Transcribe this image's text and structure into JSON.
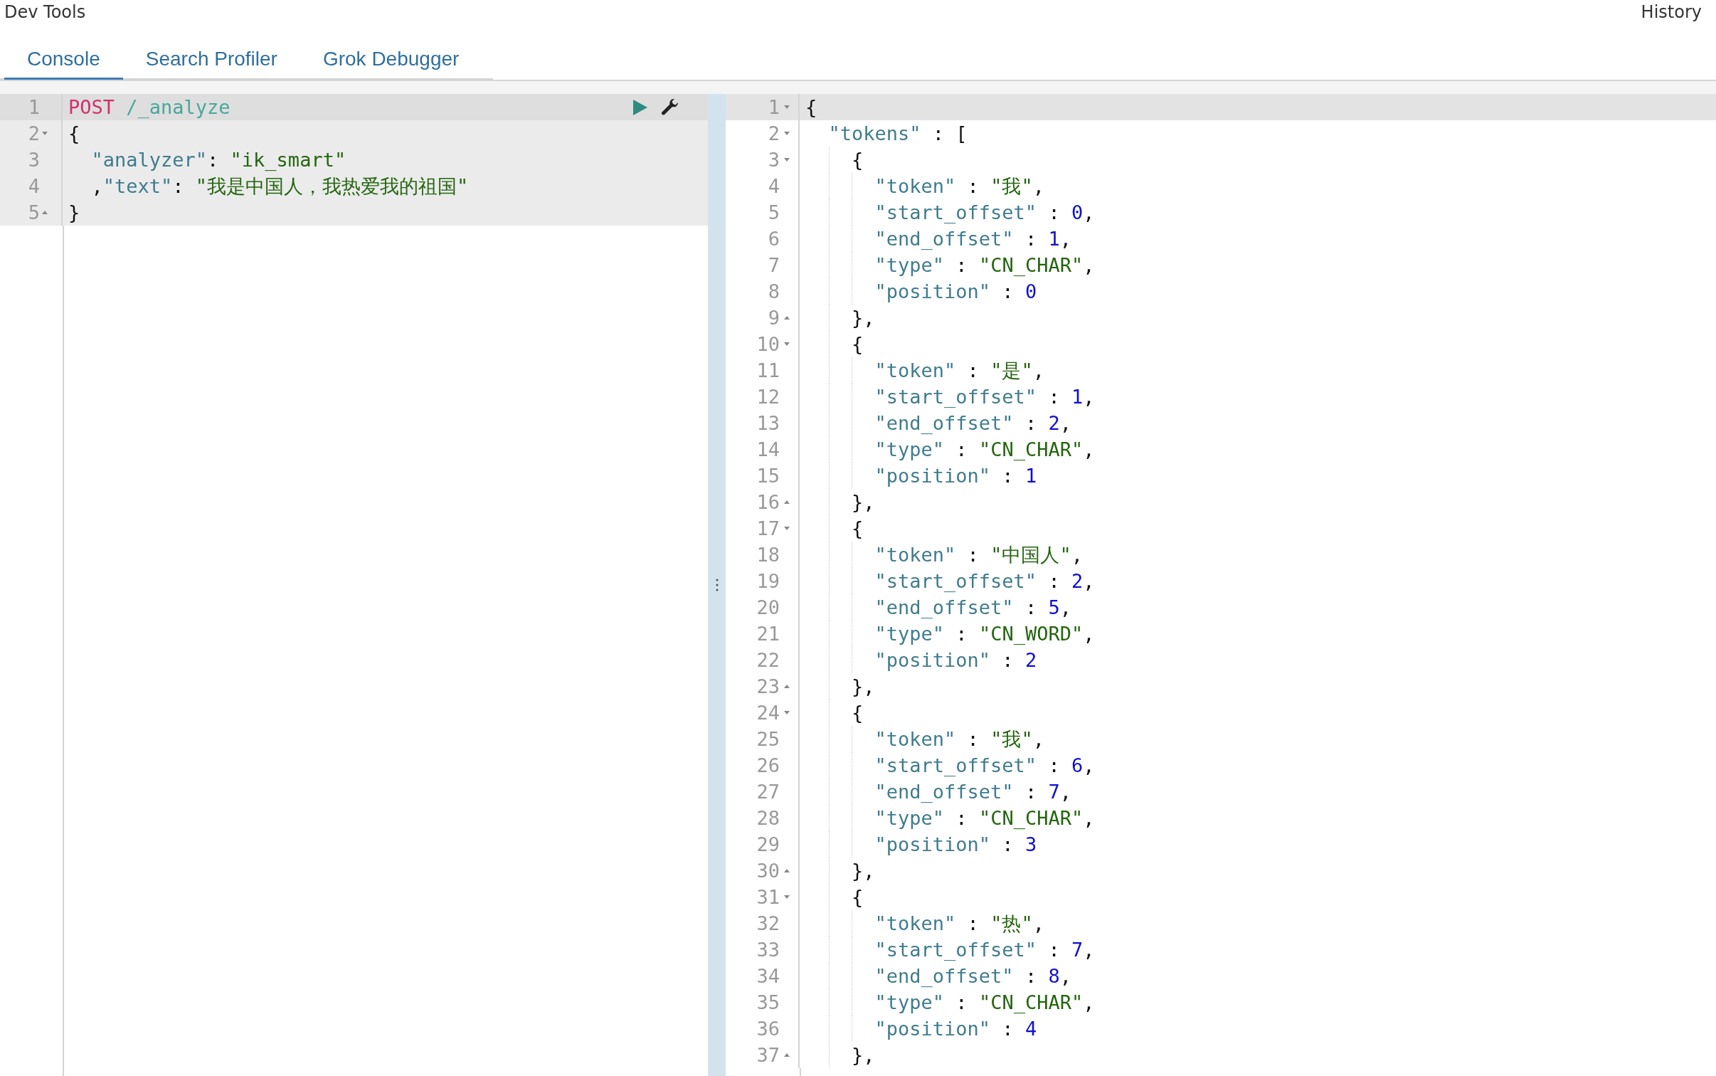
{
  "header": {
    "title": "Dev Tools",
    "history_link": "History"
  },
  "tabs": [
    {
      "label": "Console",
      "selected": true
    },
    {
      "label": "Search Profiler",
      "selected": false
    },
    {
      "label": "Grok Debugger",
      "selected": false
    }
  ],
  "request_editor": {
    "lines": [
      {
        "number": "1",
        "kind": "plain",
        "active": true,
        "in_request": true,
        "actions": true,
        "segments": [
          {
            "kind": "method",
            "text": "POST"
          },
          {
            "kind": "path",
            "text": "/_analyze"
          }
        ]
      },
      {
        "number": "2",
        "kind": "fold_start",
        "active": false,
        "in_request": true,
        "actions": false,
        "segments": [
          {
            "kind": "punct",
            "text": "{"
          }
        ]
      },
      {
        "number": "3",
        "kind": "plain",
        "active": false,
        "in_request": true,
        "actions": false,
        "segments": [
          {
            "kind": "key",
            "text": "\"analyzer\""
          },
          {
            "kind": "punct",
            "text": ": "
          },
          {
            "kind": "string",
            "text": "\"ik_smart\""
          }
        ]
      },
      {
        "number": "4",
        "kind": "plain",
        "active": false,
        "in_request": true,
        "actions": false,
        "segments": [
          {
            "kind": "punct",
            "text": ","
          },
          {
            "kind": "key",
            "text": "\"text\""
          },
          {
            "kind": "punct",
            "text": ": "
          },
          {
            "kind": "string",
            "text": "\"我是中国人，我热爱我的祖国\""
          }
        ]
      },
      {
        "number": "5",
        "kind": "fold_end",
        "active": false,
        "in_request": true,
        "actions": false,
        "segments": [
          {
            "kind": "punct",
            "text": "}"
          }
        ]
      }
    ]
  },
  "response_editor": {
    "lines": [
      {
        "number": "1",
        "kind": "fold_start",
        "active": true,
        "segments": [
          {
            "kind": "punct",
            "text": "{"
          }
        ]
      },
      {
        "number": "2",
        "kind": "fold_start",
        "active": false,
        "segments": [
          {
            "kind": "key",
            "text": "\"tokens\""
          },
          {
            "kind": "punct",
            "text": " : ["
          }
        ]
      },
      {
        "number": "3",
        "kind": "fold_start",
        "active": false,
        "segments": [
          {
            "kind": "punct",
            "text": "{"
          }
        ]
      },
      {
        "number": "4",
        "kind": "plain",
        "active": false,
        "segments": [
          {
            "kind": "key",
            "text": "\"token\""
          },
          {
            "kind": "punct",
            "text": " : "
          },
          {
            "kind": "string",
            "text": "\"我\""
          },
          {
            "kind": "punct",
            "text": ","
          }
        ]
      },
      {
        "number": "5",
        "kind": "plain",
        "active": false,
        "segments": [
          {
            "kind": "key",
            "text": "\"start_offset\""
          },
          {
            "kind": "punct",
            "text": " : "
          },
          {
            "kind": "number",
            "text": "0"
          },
          {
            "kind": "punct",
            "text": ","
          }
        ]
      },
      {
        "number": "6",
        "kind": "plain",
        "active": false,
        "segments": [
          {
            "kind": "key",
            "text": "\"end_offset\""
          },
          {
            "kind": "punct",
            "text": " : "
          },
          {
            "kind": "number",
            "text": "1"
          },
          {
            "kind": "punct",
            "text": ","
          }
        ]
      },
      {
        "number": "7",
        "kind": "plain",
        "active": false,
        "segments": [
          {
            "kind": "key",
            "text": "\"type\""
          },
          {
            "kind": "punct",
            "text": " : "
          },
          {
            "kind": "string",
            "text": "\"CN_CHAR\""
          },
          {
            "kind": "punct",
            "text": ","
          }
        ]
      },
      {
        "number": "8",
        "kind": "plain",
        "active": false,
        "segments": [
          {
            "kind": "key",
            "text": "\"position\""
          },
          {
            "kind": "punct",
            "text": " : "
          },
          {
            "kind": "number",
            "text": "0"
          }
        ]
      },
      {
        "number": "9",
        "kind": "fold_end",
        "active": false,
        "segments": [
          {
            "kind": "punct",
            "text": "},"
          }
        ]
      },
      {
        "number": "10",
        "kind": "fold_start",
        "active": false,
        "segments": [
          {
            "kind": "punct",
            "text": "{"
          }
        ]
      },
      {
        "number": "11",
        "kind": "plain",
        "active": false,
        "segments": [
          {
            "kind": "key",
            "text": "\"token\""
          },
          {
            "kind": "punct",
            "text": " : "
          },
          {
            "kind": "string",
            "text": "\"是\""
          },
          {
            "kind": "punct",
            "text": ","
          }
        ]
      },
      {
        "number": "12",
        "kind": "plain",
        "active": false,
        "segments": [
          {
            "kind": "key",
            "text": "\"start_offset\""
          },
          {
            "kind": "punct",
            "text": " : "
          },
          {
            "kind": "number",
            "text": "1"
          },
          {
            "kind": "punct",
            "text": ","
          }
        ]
      },
      {
        "number": "13",
        "kind": "plain",
        "active": false,
        "segments": [
          {
            "kind": "key",
            "text": "\"end_offset\""
          },
          {
            "kind": "punct",
            "text": " : "
          },
          {
            "kind": "number",
            "text": "2"
          },
          {
            "kind": "punct",
            "text": ","
          }
        ]
      },
      {
        "number": "14",
        "kind": "plain",
        "active": false,
        "segments": [
          {
            "kind": "key",
            "text": "\"type\""
          },
          {
            "kind": "punct",
            "text": " : "
          },
          {
            "kind": "string",
            "text": "\"CN_CHAR\""
          },
          {
            "kind": "punct",
            "text": ","
          }
        ]
      },
      {
        "number": "15",
        "kind": "plain",
        "active": false,
        "segments": [
          {
            "kind": "key",
            "text": "\"position\""
          },
          {
            "kind": "punct",
            "text": " : "
          },
          {
            "kind": "number",
            "text": "1"
          }
        ]
      },
      {
        "number": "16",
        "kind": "fold_end",
        "active": false,
        "segments": [
          {
            "kind": "punct",
            "text": "},"
          }
        ]
      },
      {
        "number": "17",
        "kind": "fold_start",
        "active": false,
        "segments": [
          {
            "kind": "punct",
            "text": "{"
          }
        ]
      },
      {
        "number": "18",
        "kind": "plain",
        "active": false,
        "segments": [
          {
            "kind": "key",
            "text": "\"token\""
          },
          {
            "kind": "punct",
            "text": " : "
          },
          {
            "kind": "string",
            "text": "\"中国人\""
          },
          {
            "kind": "punct",
            "text": ","
          }
        ]
      },
      {
        "number": "19",
        "kind": "plain",
        "active": false,
        "segments": [
          {
            "kind": "key",
            "text": "\"start_offset\""
          },
          {
            "kind": "punct",
            "text": " : "
          },
          {
            "kind": "number",
            "text": "2"
          },
          {
            "kind": "punct",
            "text": ","
          }
        ]
      },
      {
        "number": "20",
        "kind": "plain",
        "active": false,
        "segments": [
          {
            "kind": "key",
            "text": "\"end_offset\""
          },
          {
            "kind": "punct",
            "text": " : "
          },
          {
            "kind": "number",
            "text": "5"
          },
          {
            "kind": "punct",
            "text": ","
          }
        ]
      },
      {
        "number": "21",
        "kind": "plain",
        "active": false,
        "segments": [
          {
            "kind": "key",
            "text": "\"type\""
          },
          {
            "kind": "punct",
            "text": " : "
          },
          {
            "kind": "string",
            "text": "\"CN_WORD\""
          },
          {
            "kind": "punct",
            "text": ","
          }
        ]
      },
      {
        "number": "22",
        "kind": "plain",
        "active": false,
        "segments": [
          {
            "kind": "key",
            "text": "\"position\""
          },
          {
            "kind": "punct",
            "text": " : "
          },
          {
            "kind": "number",
            "text": "2"
          }
        ]
      },
      {
        "number": "23",
        "kind": "fold_end",
        "active": false,
        "segments": [
          {
            "kind": "punct",
            "text": "},"
          }
        ]
      },
      {
        "number": "24",
        "kind": "fold_start",
        "active": false,
        "segments": [
          {
            "kind": "punct",
            "text": "{"
          }
        ]
      },
      {
        "number": "25",
        "kind": "plain",
        "active": false,
        "segments": [
          {
            "kind": "key",
            "text": "\"token\""
          },
          {
            "kind": "punct",
            "text": " : "
          },
          {
            "kind": "string",
            "text": "\"我\""
          },
          {
            "kind": "punct",
            "text": ","
          }
        ]
      },
      {
        "number": "26",
        "kind": "plain",
        "active": false,
        "segments": [
          {
            "kind": "key",
            "text": "\"start_offset\""
          },
          {
            "kind": "punct",
            "text": " : "
          },
          {
            "kind": "number",
            "text": "6"
          },
          {
            "kind": "punct",
            "text": ","
          }
        ]
      },
      {
        "number": "27",
        "kind": "plain",
        "active": false,
        "segments": [
          {
            "kind": "key",
            "text": "\"end_offset\""
          },
          {
            "kind": "punct",
            "text": " : "
          },
          {
            "kind": "number",
            "text": "7"
          },
          {
            "kind": "punct",
            "text": ","
          }
        ]
      },
      {
        "number": "28",
        "kind": "plain",
        "active": false,
        "segments": [
          {
            "kind": "key",
            "text": "\"type\""
          },
          {
            "kind": "punct",
            "text": " : "
          },
          {
            "kind": "string",
            "text": "\"CN_CHAR\""
          },
          {
            "kind": "punct",
            "text": ","
          }
        ]
      },
      {
        "number": "29",
        "kind": "plain",
        "active": false,
        "segments": [
          {
            "kind": "key",
            "text": "\"position\""
          },
          {
            "kind": "punct",
            "text": " : "
          },
          {
            "kind": "number",
            "text": "3"
          }
        ]
      },
      {
        "number": "30",
        "kind": "fold_end",
        "active": false,
        "segments": [
          {
            "kind": "punct",
            "text": "},"
          }
        ]
      },
      {
        "number": "31",
        "kind": "fold_start",
        "active": false,
        "segments": [
          {
            "kind": "punct",
            "text": "{"
          }
        ]
      },
      {
        "number": "32",
        "kind": "plain",
        "active": false,
        "segments": [
          {
            "kind": "key",
            "text": "\"token\""
          },
          {
            "kind": "punct",
            "text": " : "
          },
          {
            "kind": "string",
            "text": "\"热\""
          },
          {
            "kind": "punct",
            "text": ","
          }
        ]
      },
      {
        "number": "33",
        "kind": "plain",
        "active": false,
        "segments": [
          {
            "kind": "key",
            "text": "\"start_offset\""
          },
          {
            "kind": "punct",
            "text": " : "
          },
          {
            "kind": "number",
            "text": "7"
          },
          {
            "kind": "punct",
            "text": ","
          }
        ]
      },
      {
        "number": "34",
        "kind": "plain",
        "active": false,
        "segments": [
          {
            "kind": "key",
            "text": "\"end_offset\""
          },
          {
            "kind": "punct",
            "text": " : "
          },
          {
            "kind": "number",
            "text": "8"
          },
          {
            "kind": "punct",
            "text": ","
          }
        ]
      },
      {
        "number": "35",
        "kind": "plain",
        "active": false,
        "segments": [
          {
            "kind": "key",
            "text": "\"type\""
          },
          {
            "kind": "punct",
            "text": " : "
          },
          {
            "kind": "string",
            "text": "\"CN_CHAR\""
          },
          {
            "kind": "punct",
            "text": ","
          }
        ]
      },
      {
        "number": "36",
        "kind": "plain",
        "active": false,
        "segments": [
          {
            "kind": "key",
            "text": "\"position\""
          },
          {
            "kind": "punct",
            "text": " : "
          },
          {
            "kind": "number",
            "text": "4"
          }
        ]
      },
      {
        "number": "37",
        "kind": "fold_end",
        "active": false,
        "segments": [
          {
            "kind": "punct",
            "text": "},"
          }
        ]
      }
    ]
  }
}
